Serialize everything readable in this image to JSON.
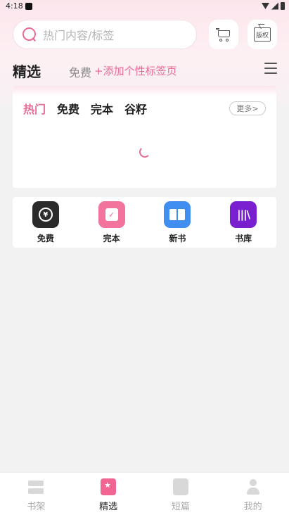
{
  "status_bar": {
    "time": "4:18"
  },
  "search": {
    "placeholder": "热门内容/标签"
  },
  "header_icons": {
    "cart": "cart-icon",
    "copyright": "copyright-icon",
    "copyright_text": "版权"
  },
  "tabs": {
    "selected": "精选",
    "free": "免费",
    "add_tag": "+添加个性标签页"
  },
  "hot_card": {
    "tabs": [
      "热门",
      "免费",
      "完本",
      "谷籽"
    ],
    "more": "更多>"
  },
  "shortcuts": [
    {
      "label": "免费",
      "icon": "free-icon",
      "glyph": "¥"
    },
    {
      "label": "完本",
      "icon": "finished-icon",
      "glyph": "✓"
    },
    {
      "label": "新书",
      "icon": "new-book-icon",
      "glyph": ""
    },
    {
      "label": "书库",
      "icon": "library-icon",
      "glyph": "|||\\"
    }
  ],
  "bottom_nav": [
    {
      "label": "书架",
      "icon": "bookshelf-icon"
    },
    {
      "label": "精选",
      "icon": "featured-icon"
    },
    {
      "label": "短篇",
      "icon": "short-story-icon"
    },
    {
      "label": "我的",
      "icon": "profile-icon"
    }
  ],
  "colors": {
    "accent": "#e86b94",
    "background": "#f2f2f2"
  }
}
